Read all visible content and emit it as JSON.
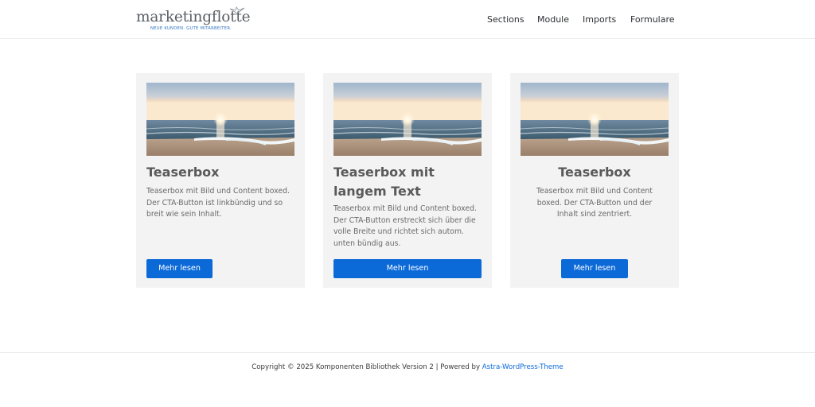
{
  "header": {
    "logo_text": "marketingflotte",
    "logo_tagline": "NEUE KUNDEN. GUTE MITARBEITER.",
    "nav": [
      "Sections",
      "Module",
      "Imports",
      "Formulare"
    ]
  },
  "cards": [
    {
      "title": "Teaserbox",
      "text": "Teaserbox mit Bild und Content boxed. Der CTA-Button ist linkbündig und so breit wie sein Inhalt.",
      "button": "Mehr lesen",
      "image": "beach-sunset-image"
    },
    {
      "title": "Teaserbox mit langem Text",
      "text": "Teaserbox mit Bild und Content boxed. Der CTA-Button erstreckt sich über die volle Breite und richtet sich autom. unten bündig aus.",
      "button": "Mehr lesen",
      "image": "beach-sunset-image"
    },
    {
      "title": "Teaserbox",
      "text": "Teaserbox mit Bild und Content boxed. Der CTA-Button und der Inhalt sind zentriert.",
      "button": "Mehr lesen",
      "image": "beach-sunset-image"
    }
  ],
  "footer": {
    "prefix": "Copyright © 2025 Komponenten Bibliothek Version 2 | Powered by ",
    "link": "Astra-WordPress-Theme"
  },
  "colors": {
    "accent": "#0b69d8",
    "card_bg": "#f3f3f3",
    "logo_blue": "#2c73c4"
  }
}
